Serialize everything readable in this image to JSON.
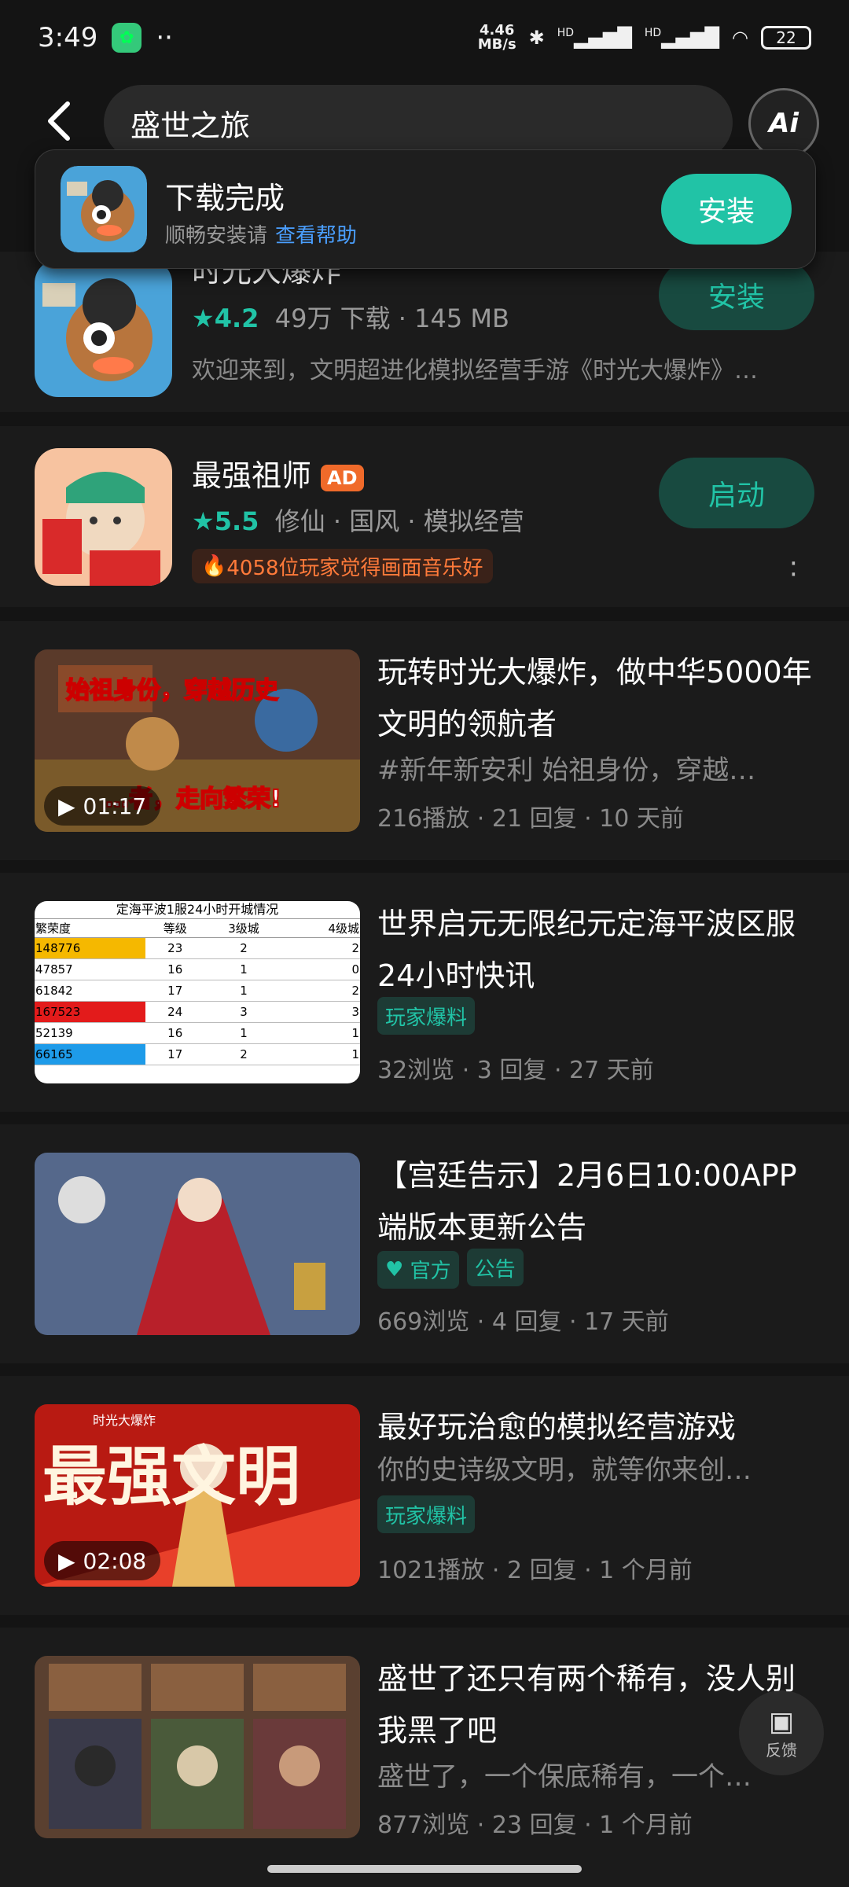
{
  "status": {
    "time": "3:49",
    "dots": "··",
    "net_speed_value": "4.46",
    "net_speed_unit": "MB/s",
    "signal1": "HD",
    "signal2": "HD",
    "battery": "22"
  },
  "search": {
    "query": "盛世之旅",
    "ai_label": "Ai"
  },
  "toast": {
    "title": "下载完成",
    "subtitle": "顺畅安装请",
    "help_link": "查看帮助",
    "install": "安装"
  },
  "apps": [
    {
      "name": "时光大爆炸",
      "rating": "4.2",
      "meta": "49万 下载 · 145 MB",
      "desc": "欢迎来到，文明超进化模拟经营手游《时光大爆炸》…",
      "button": "安装"
    },
    {
      "name": "最强祖师",
      "ad": "AD",
      "rating": "5.5",
      "meta": "修仙 · 国风 · 模拟经营",
      "hot": "4058位玩家觉得画面音乐好",
      "button": "启动"
    }
  ],
  "posts": [
    {
      "title": "玩转时光大爆炸，做中华5000年文明的领航者",
      "sub": "#新年新安利 始祖身份，穿越…",
      "stats": "216播放 · 21 回复 · 10 天前",
      "video": "01:17",
      "thumb_text1": "始祖身份，穿越历史",
      "thumb_text2": "…者，走向繁荣!"
    },
    {
      "title": "世界启元无限纪元定海平波区服24小时快讯",
      "tag": "玩家爆料",
      "stats": "32浏览 · 3 回复 · 27 天前",
      "table": {
        "title": "定海平波1服24小时开城情况",
        "headers": [
          "繁荣度",
          "等级",
          "3级城",
          "4级城"
        ],
        "rows": [
          [
            "148776",
            "23",
            "2",
            "2"
          ],
          [
            "47857",
            "16",
            "1",
            "0"
          ],
          [
            "61842",
            "17",
            "1",
            "2"
          ],
          [
            "167523",
            "24",
            "3",
            "3"
          ],
          [
            "52139",
            "16",
            "1",
            "1"
          ],
          [
            "66165",
            "17",
            "2",
            "1"
          ]
        ],
        "row_colors": [
          "#f5b800",
          "#ffffff",
          "#ffffff",
          "#e31b1b",
          "#ffffff",
          "#1e9be9"
        ]
      }
    },
    {
      "title": "【宫廷告示】2月6日10:00APP端版本更新公告",
      "tags": [
        "官方",
        "公告"
      ],
      "stats": "669浏览 · 4 回复 · 17 天前"
    },
    {
      "title": "最好玩治愈的模拟经营游戏",
      "sub": "你的史诗级文明，就等你来创…",
      "tag": "玩家爆料",
      "stats": "1021播放 · 2 回复 · 1 个月前",
      "video": "02:08",
      "thumb_text": "最强文明",
      "thumb_top": "时光大爆炸"
    },
    {
      "title": "盛世了还只有两个稀有，没人别我黑了吧",
      "sub": "盛世了，一个保底稀有，一个…",
      "stats": "877浏览 · 23 回复 · 1 个月前"
    }
  ],
  "feedback": "反馈"
}
